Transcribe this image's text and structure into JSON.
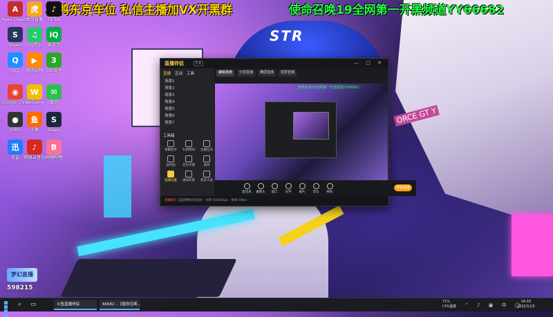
{
  "overlay": {
    "left_text": "站鸭东京车位 私信主播加VX开黑群",
    "right_text": "使命召唤19全网第一开黑频道YY66682"
  },
  "wallpaper": {
    "helmet_text": "STR",
    "robot_text": "ORCE GT Y"
  },
  "desktop_icons": [
    {
      "label": "Apex Legends",
      "icon": "A",
      "color": "#c62b2b"
    },
    {
      "label": "虎牙直播",
      "icon": "虎",
      "color": "#f5a623"
    },
    {
      "label": "TikTok",
      "icon": "♪",
      "color": "#111111"
    },
    {
      "label": "Steam",
      "icon": "S",
      "color": "#25385a"
    },
    {
      "label": "QQ音乐",
      "icon": "♫",
      "color": "#2bc56b"
    },
    {
      "label": "爱奇艺",
      "icon": "iQ",
      "color": "#00b140"
    },
    {
      "label": "QQ",
      "icon": "Q",
      "color": "#1e90ff"
    },
    {
      "label": "腾讯视频",
      "icon": "▶",
      "color": "#ff8a00"
    },
    {
      "label": "360安全",
      "icon": "3",
      "color": "#2aa82a"
    },
    {
      "label": "Google Chrome",
      "icon": "◉",
      "color": "#e84335"
    },
    {
      "label": "WeGame",
      "icon": "W",
      "color": "#f0c000"
    },
    {
      "label": "微信",
      "icon": "✉",
      "color": "#27c24c"
    },
    {
      "label": "OBS",
      "icon": "●",
      "color": "#333333"
    },
    {
      "label": "斗鱼",
      "icon": "鱼",
      "color": "#ff6a00"
    },
    {
      "label": "Steam",
      "icon": "S",
      "color": "#1b2838"
    },
    {
      "label": "迅雷",
      "icon": "迅",
      "color": "#1f7cff"
    },
    {
      "label": "网易云音乐",
      "icon": "♪",
      "color": "#d6281f"
    },
    {
      "label": "哔哩哔哩",
      "icon": "B",
      "color": "#fb7299"
    }
  ],
  "watermark": {
    "logo_text": "梦幻直播",
    "id": "598215"
  },
  "app": {
    "logo": "直播伴侣",
    "version": "5.6",
    "controls": "— □ ✕",
    "side_tabs": [
      "直播",
      "互动",
      "工具"
    ],
    "scenes": [
      "场景1",
      "场景2",
      "场景3",
      "场景4",
      "场景5",
      "场景6",
      "场景7"
    ],
    "tools_title": "工具箱",
    "tools": [
      "弹幕助手",
      "礼物特效",
      "主播任务",
      "画中画",
      "音乐点播",
      "录屏",
      "直播设置",
      "虚拟形象",
      "更多工具"
    ],
    "main_tabs": [
      "编辑场景",
      "分屏直播",
      "横屏直播",
      "竖屏直播"
    ],
    "preview_text": "使命召唤19全网第一开黑频道YY66682",
    "bottom_items": [
      "麦克风",
      "摄像头",
      "窗口",
      "文字",
      "图片",
      "音乐",
      "特效"
    ],
    "live_button": "开始直播",
    "status_prefix": "直播提示",
    "status_text": "当前网络状况良好 · 码率 6000kbps · 帧率 60fps"
  },
  "taskbar": {
    "apps": [
      "斗鱼直播伴侣",
      "66682 - 【使命召唤..."
    ],
    "tray_label": "CPU温度",
    "tray_value": "71%",
    "time": "14:33",
    "date": "2022/11/3",
    "icons": "⌃ ♪ ▣ 中 ◯"
  }
}
